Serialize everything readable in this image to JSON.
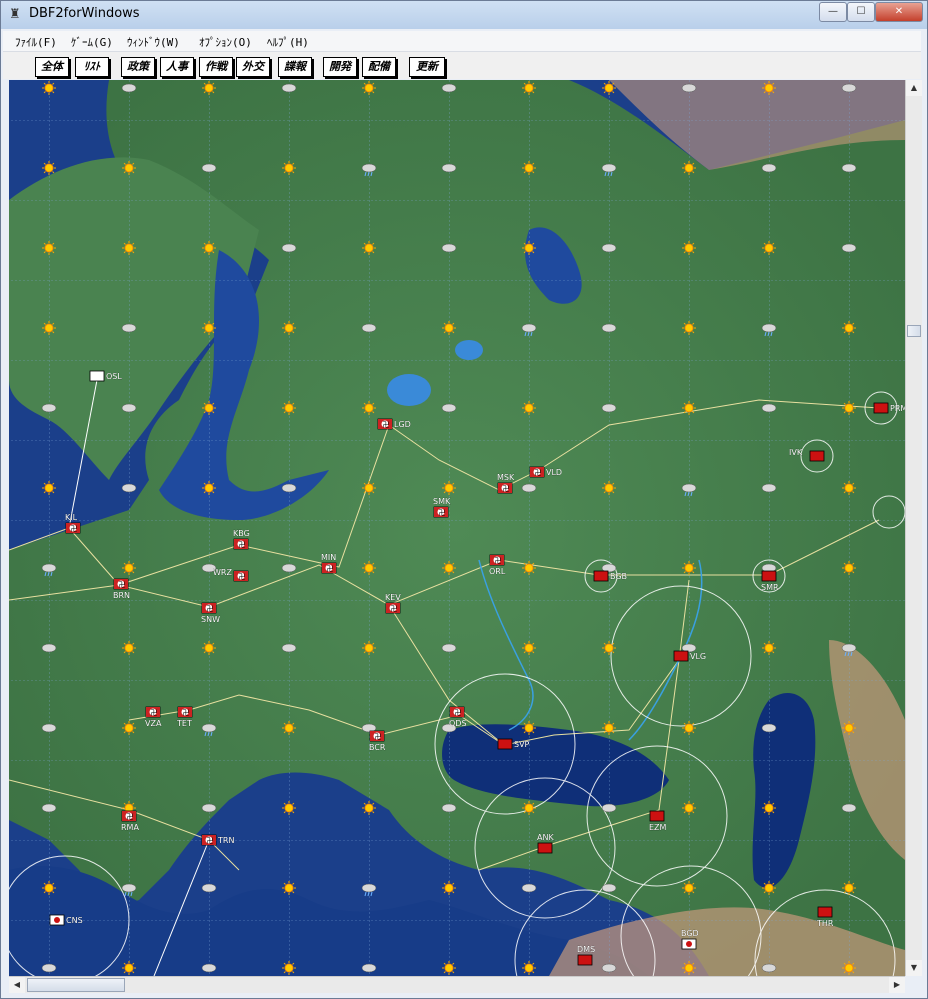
{
  "window": {
    "title": "DBF2forWindows",
    "app_icon": "app-icon"
  },
  "controls": {
    "min": "—",
    "max": "☐",
    "close": "✕"
  },
  "menu": [
    "ﾌｧｲﾙ(F)",
    "ｹﾞｰﾑ(G)",
    "ｳｨﾝﾄﾞｳ(W)",
    "ｵﾌﾟｼｮﾝ(O)",
    "ﾍﾙﾌﾟ(H)"
  ],
  "toolbar": [
    "全体",
    "ﾘｽﾄ",
    "政策",
    "人事",
    "作戦",
    "外交",
    "諜報",
    "開発",
    "配備",
    "更新"
  ],
  "colors": {
    "axis_flag": "#ffffff",
    "soviet_flag": "#cc1111",
    "allied_flag": "#ffffff",
    "river": "#3aa0e0",
    "road": "#e8e0a0",
    "sea": "#1b3f8a"
  },
  "cities": [
    {
      "code": "OSL",
      "faction": "neutral"
    },
    {
      "code": "LGD",
      "faction": "axis"
    },
    {
      "code": "MSK",
      "faction": "axis"
    },
    {
      "code": "VLD",
      "faction": "axis"
    },
    {
      "code": "KIL",
      "faction": "axis"
    },
    {
      "code": "SMK",
      "faction": "axis"
    },
    {
      "code": "KBG",
      "faction": "axis"
    },
    {
      "code": "MIN",
      "faction": "axis"
    },
    {
      "code": "ORL",
      "faction": "axis"
    },
    {
      "code": "BRN",
      "faction": "axis"
    },
    {
      "code": "WRZ",
      "faction": "axis"
    },
    {
      "code": "KEV",
      "faction": "axis"
    },
    {
      "code": "SNW",
      "faction": "axis"
    },
    {
      "code": "VZA",
      "faction": "axis"
    },
    {
      "code": "TET",
      "faction": "axis"
    },
    {
      "code": "ODS",
      "faction": "axis"
    },
    {
      "code": "BCR",
      "faction": "axis"
    },
    {
      "code": "RMA",
      "faction": "axis"
    },
    {
      "code": "TRN",
      "faction": "axis"
    },
    {
      "code": "PRM",
      "faction": "soviet"
    },
    {
      "code": "IVK",
      "faction": "soviet"
    },
    {
      "code": "BGB",
      "faction": "soviet"
    },
    {
      "code": "SMR",
      "faction": "soviet"
    },
    {
      "code": "VLG",
      "faction": "soviet"
    },
    {
      "code": "SVP",
      "faction": "soviet"
    },
    {
      "code": "ANK",
      "faction": "soviet"
    },
    {
      "code": "EZM",
      "faction": "soviet"
    },
    {
      "code": "DMS",
      "faction": "soviet"
    },
    {
      "code": "BGD",
      "faction": "japan"
    },
    {
      "code": "THR",
      "faction": "soviet"
    },
    {
      "code": "CNS",
      "faction": "japan"
    }
  ],
  "weather_icons": [
    "sun-icon",
    "cloud-icon",
    "rain-icon",
    "storm-icon"
  ]
}
